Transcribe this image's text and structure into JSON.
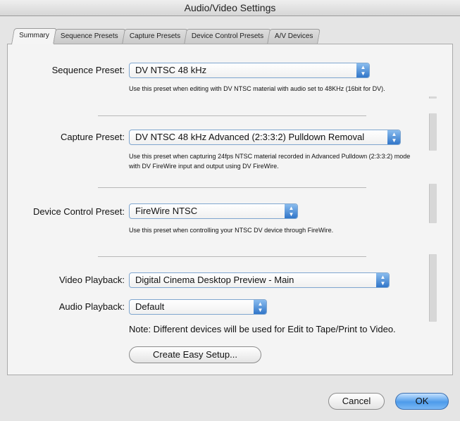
{
  "window": {
    "title": "Audio/Video Settings"
  },
  "tabs": [
    {
      "label": "Summary"
    },
    {
      "label": "Sequence Presets"
    },
    {
      "label": "Capture Presets"
    },
    {
      "label": "Device Control Presets"
    },
    {
      "label": "A/V Devices"
    }
  ],
  "sequence": {
    "label": "Sequence Preset:",
    "value": "DV NTSC 48 kHz",
    "description": "Use this preset when editing with DV NTSC material with audio set to 48KHz (16bit for DV)."
  },
  "capture": {
    "label": "Capture Preset:",
    "value": "DV NTSC 48 kHz Advanced (2:3:3:2) Pulldown Removal",
    "description_line1": "Use this preset when capturing 24fps NTSC material recorded in Advanced Pulldown (2:3:3:2) mode",
    "description_line2": "with DV FireWire input and output using DV FireWire."
  },
  "device_control": {
    "label": "Device Control Preset:",
    "value": "FireWire NTSC",
    "description": "Use this preset when controlling your NTSC DV device through FireWire."
  },
  "video_playback": {
    "label": "Video Playback:",
    "value": "Digital Cinema Desktop Preview - Main"
  },
  "audio_playback": {
    "label": "Audio Playback:",
    "value": "Default"
  },
  "note": "Note: Different devices will be used for Edit to Tape/Print to Video.",
  "buttons": {
    "easy_setup": "Create Easy Setup...",
    "cancel": "Cancel",
    "ok": "OK"
  },
  "popup_arrow_glyph": "▲▼"
}
